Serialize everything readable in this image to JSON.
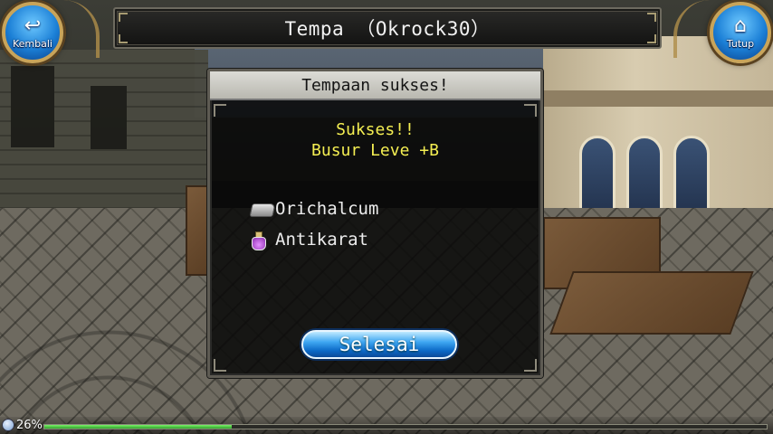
{
  "header": {
    "title": "Tempa （Okrock30）",
    "back_button": {
      "label": "Kembali",
      "icon": "back-arrow-icon"
    },
    "close_button": {
      "label": "Tutup",
      "icon": "home-icon"
    }
  },
  "dialog": {
    "title": "Tempaan sukses!",
    "result_line_1": "Sukses!!",
    "result_line_2": "Busur Leve +B",
    "materials": [
      {
        "name": "Orichalcum",
        "icon": "ore-ingot-icon"
      },
      {
        "name": "Antikarat",
        "icon": "potion-icon"
      }
    ],
    "done_button": "Selesai"
  },
  "status": {
    "exp_percent_text": "26%",
    "exp_percent": 26
  },
  "colors": {
    "result_text": "#f4ee52",
    "button_blue": "#1b7fd6",
    "exp_fill": "#2ea22a"
  }
}
